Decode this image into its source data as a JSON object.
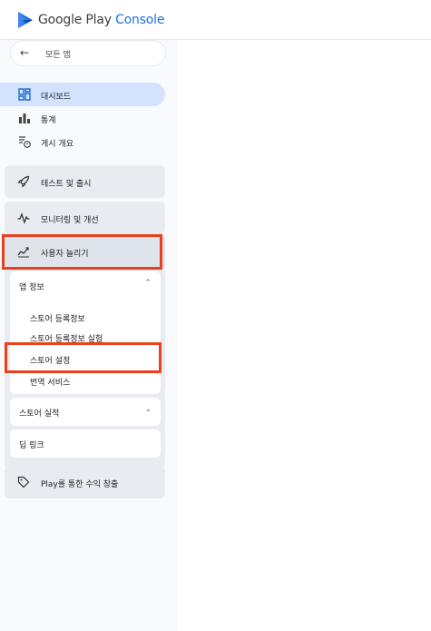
{
  "header": {
    "brand_primary": "Google Play",
    "brand_secondary": "Console"
  },
  "sidebar": {
    "back_label": "모든 앱",
    "items": [
      {
        "label": "대시보드",
        "icon": "dashboard-icon",
        "active": true
      },
      {
        "label": "통계",
        "icon": "bar-chart-icon",
        "active": false
      },
      {
        "label": "게시 개요",
        "icon": "publishing-overview-icon",
        "active": false
      }
    ],
    "sections": [
      {
        "label": "테스트 및 출시",
        "icon": "rocket-icon"
      },
      {
        "label": "모니터링 및 개선",
        "icon": "vitals-icon"
      },
      {
        "label": "사용자 늘리기",
        "icon": "grow-users-icon"
      },
      {
        "label": "Play를 통한 수익 창출",
        "icon": "tag-icon"
      }
    ],
    "app_info": {
      "label": "앱 정보",
      "items": [
        "스토어 등록정보",
        "스토어 등록정보 실험",
        "스토어 설정",
        "번역 서비스"
      ]
    },
    "store_performance": "스토어 실적",
    "deep_links": "딥 링크"
  },
  "colors": {
    "accent": "#1a73e8",
    "active_bg": "#d3e3fd",
    "highlight": "#e8411b",
    "section_bg": "#e8ebf0"
  }
}
